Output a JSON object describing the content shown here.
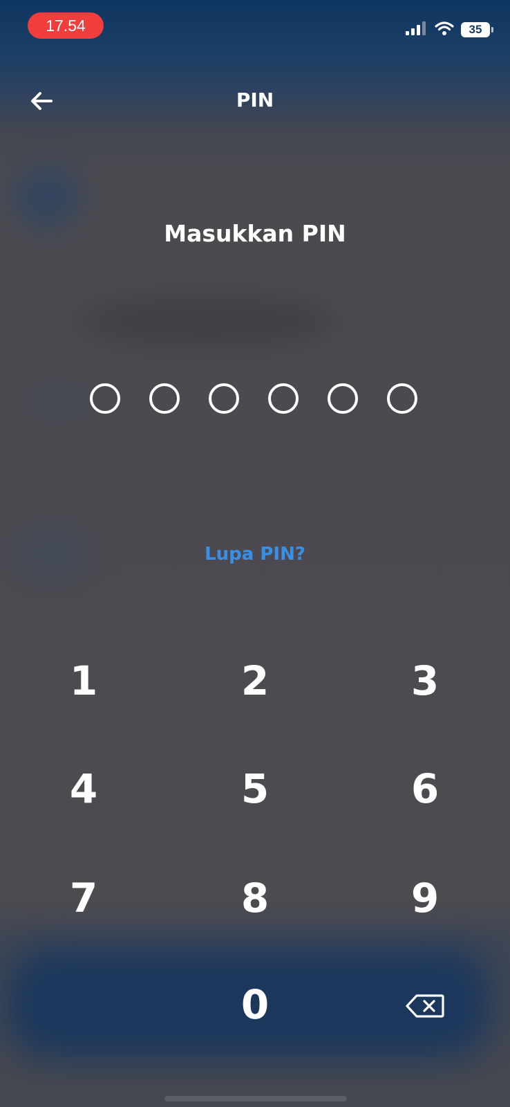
{
  "status_bar": {
    "time": "17.54",
    "battery_level": "35",
    "icons": [
      "signal-icon",
      "wifi-icon",
      "battery-icon"
    ]
  },
  "header": {
    "title": "PIN",
    "back_icon": "arrow-left-icon"
  },
  "prompt": "Masukkan PIN",
  "pin": {
    "length": 6,
    "filled": 0
  },
  "forgot_pin": "Lupa PIN?",
  "keypad": {
    "keys": [
      "1",
      "2",
      "3",
      "4",
      "5",
      "6",
      "7",
      "8",
      "9",
      "0"
    ],
    "delete_icon": "backspace-icon"
  },
  "colors": {
    "accent_link": "#3a8fe6",
    "time_pill": "#f23d3d",
    "header_bg": "#0f3561"
  }
}
